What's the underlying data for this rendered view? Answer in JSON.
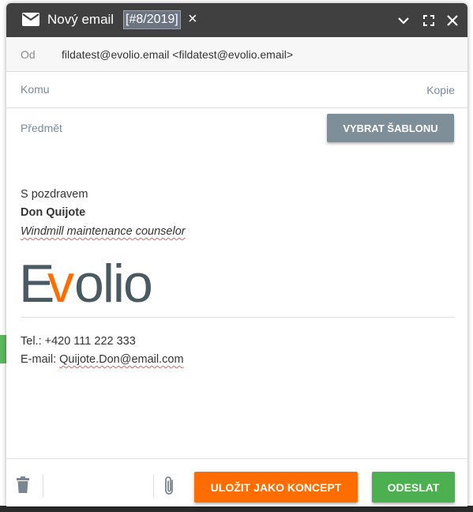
{
  "window": {
    "title": "Nový email",
    "tag": "[#8/2019]",
    "tag_close": "×",
    "icons": [
      "mail-icon",
      "chevron-down-icon",
      "fullscreen-icon",
      "close-icon"
    ]
  },
  "from": {
    "label": "Od",
    "value": "fildatest@evolio.email <fildatest@evolio.email>"
  },
  "to": {
    "label": "Komu",
    "cc_label": "Kopie"
  },
  "subject": {
    "label": "Předmět",
    "template_button": "VYBRAT ŠABLONU"
  },
  "signature": {
    "greeting": "S pozdravem",
    "name": "Don Quijote",
    "role": "Windmill maintenance counselor",
    "logo_text": "Evolio",
    "phone": "Tel.: +420 111 222 333",
    "email_prefix": "E-mail: ",
    "email": "Quijote.Don@email.com"
  },
  "footer": {
    "save_draft": "ULOŽIT JAKO KONCEPT",
    "send": "ODESLAT",
    "icons": [
      "trash-icon",
      "paperclip-icon"
    ]
  },
  "colors": {
    "titlebar": "#404040",
    "template_button": "#7e8f99",
    "draft_button": "#ff6d00",
    "send_button": "#4caf50",
    "logo_gray": "#4a5a63",
    "logo_orange": "#ff6d00"
  }
}
